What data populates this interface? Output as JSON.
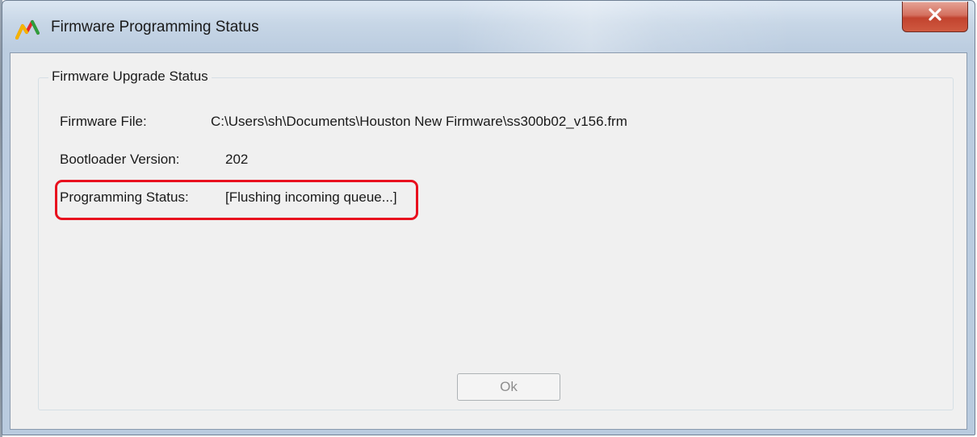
{
  "window": {
    "title": "Firmware Programming Status",
    "close_symbol": "x"
  },
  "group": {
    "title": "Firmware Upgrade Status"
  },
  "rows": [
    {
      "label": "Firmware File:",
      "value": "C:\\Users\\sh\\Documents\\Houston New Firmware\\ss300b02_v156.frm"
    },
    {
      "label": "Bootloader Version:",
      "value": "202"
    },
    {
      "label": "Programming Status:",
      "value": "[Flushing incoming queue...]"
    }
  ],
  "buttons": {
    "ok_label": "Ok",
    "ok_enabled": false
  },
  "icons": {
    "app": "waveform-chart-icon",
    "close": "close-icon"
  },
  "colors": {
    "highlight": "#e8101e",
    "close_button": "#c2432f",
    "disabled_text": "#8d8d8d"
  }
}
